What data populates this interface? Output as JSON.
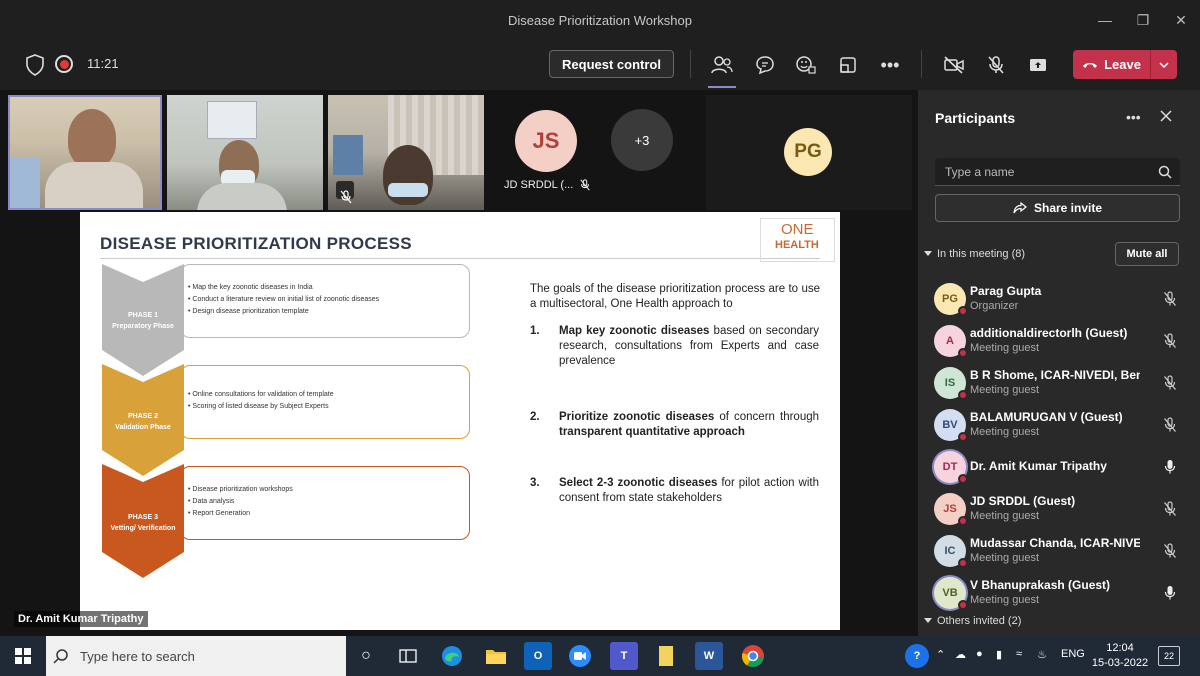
{
  "window": {
    "title": "Disease Prioritization Workshop"
  },
  "toolbar": {
    "time": "11:21",
    "request_control": "Request control",
    "leave": "Leave"
  },
  "video": {
    "js_initials": "JS",
    "js_name": "JD SRDDL (...",
    "more_count": "+3",
    "pg_initials": "PG",
    "speaker_label": "Dr. Amit Kumar Tripathy"
  },
  "slide": {
    "title": "DISEASE PRIORITIZATION PROCESS",
    "logo_one": "ONE",
    "logo_health": "HEALTH",
    "phases": [
      {
        "label1": "PHASE 1",
        "label2": "Preparatory Phase",
        "color": "#b8b8b8",
        "bullets": [
          "• Map the key zoonotic diseases in India",
          "• Conduct a literature review on initial list of zoonotic diseases",
          "• Design disease prioritization template"
        ]
      },
      {
        "label1": "PHASE 2",
        "label2": "Validation Phase",
        "color": "#d9a13a",
        "bullets": [
          "• Online consultations for validation of template",
          "• Scoring of listed disease by Subject Experts"
        ]
      },
      {
        "label1": "PHASE 3",
        "label2": "Vetting/ Verification",
        "color": "#c9581f",
        "bullets": [
          "• Disease prioritization workshops",
          "• Data analysis",
          "• Report Generation"
        ]
      }
    ],
    "goal_intro": "The goals of the disease prioritization process are to use a multisectoral, One Health approach to",
    "goals": [
      {
        "num": "1.",
        "bold": "Map key zoonotic diseases",
        "rest": " based on secondary research, consultations from Experts and case prevalence"
      },
      {
        "num": "2.",
        "bold": "Prioritize zoonotic diseases",
        "rest": " of concern through ",
        "bold2": "transparent quantitative approach"
      },
      {
        "num": "3.",
        "bold": "Select 2-3 zoonotic diseases",
        "rest": " for pilot action with consent from state stakeholders"
      }
    ]
  },
  "panel": {
    "title": "Participants",
    "search_placeholder": "Type a name",
    "share_invite": "Share invite",
    "in_meeting": "In this meeting (8)",
    "mute_all": "Mute all",
    "others_invited": "Others invited (2)",
    "participants": [
      {
        "initials": "PG",
        "name": "Parag Gupta",
        "role": "Organizer",
        "bg": "#fbe7b2",
        "fg": "#7a5a12",
        "status": "#c4314b",
        "mic": "off"
      },
      {
        "initials": "A",
        "name": "additionaldirectorlh (Guest)",
        "role": "Meeting guest",
        "bg": "#f6d3dd",
        "fg": "#a3294e",
        "status": "#c4314b",
        "mic": "off"
      },
      {
        "initials": "IS",
        "name": "B R Shome, ICAR-NIVEDI, Benga...",
        "role": "Meeting guest",
        "bg": "#cfe5d6",
        "fg": "#2e6b43",
        "status": "#c4314b",
        "mic": "off"
      },
      {
        "initials": "BV",
        "name": "BALAMURUGAN V (Guest)",
        "role": "Meeting guest",
        "bg": "#d3def0",
        "fg": "#2c4a7a",
        "status": "#c4314b",
        "mic": "off"
      },
      {
        "initials": "DT",
        "name": "Dr. Amit Kumar Tripathy",
        "role": "",
        "bg": "#f6d3dd",
        "fg": "#a3294e",
        "status": "#c4314b",
        "mic": "on"
      },
      {
        "initials": "JS",
        "name": "JD SRDDL (Guest)",
        "role": "Meeting guest",
        "bg": "#f4cfc6",
        "fg": "#b0403a",
        "status": "#c4314b",
        "mic": "off"
      },
      {
        "initials": "IC",
        "name": "Mudassar Chanda, ICAR-NIVEDI ...",
        "role": "Meeting guest",
        "bg": "#d3dde6",
        "fg": "#33506a",
        "status": "#c4314b",
        "mic": "off"
      },
      {
        "initials": "VB",
        "name": "V Bhanuprakash (Guest)",
        "role": "Meeting guest",
        "bg": "#dfe8c9",
        "fg": "#4d6320",
        "status": "#c4314b",
        "mic": "on"
      }
    ]
  },
  "taskbar": {
    "search_placeholder": "Type here to search",
    "lang": "ENG",
    "time": "12:04",
    "date": "15-03-2022",
    "notifications": "22"
  }
}
